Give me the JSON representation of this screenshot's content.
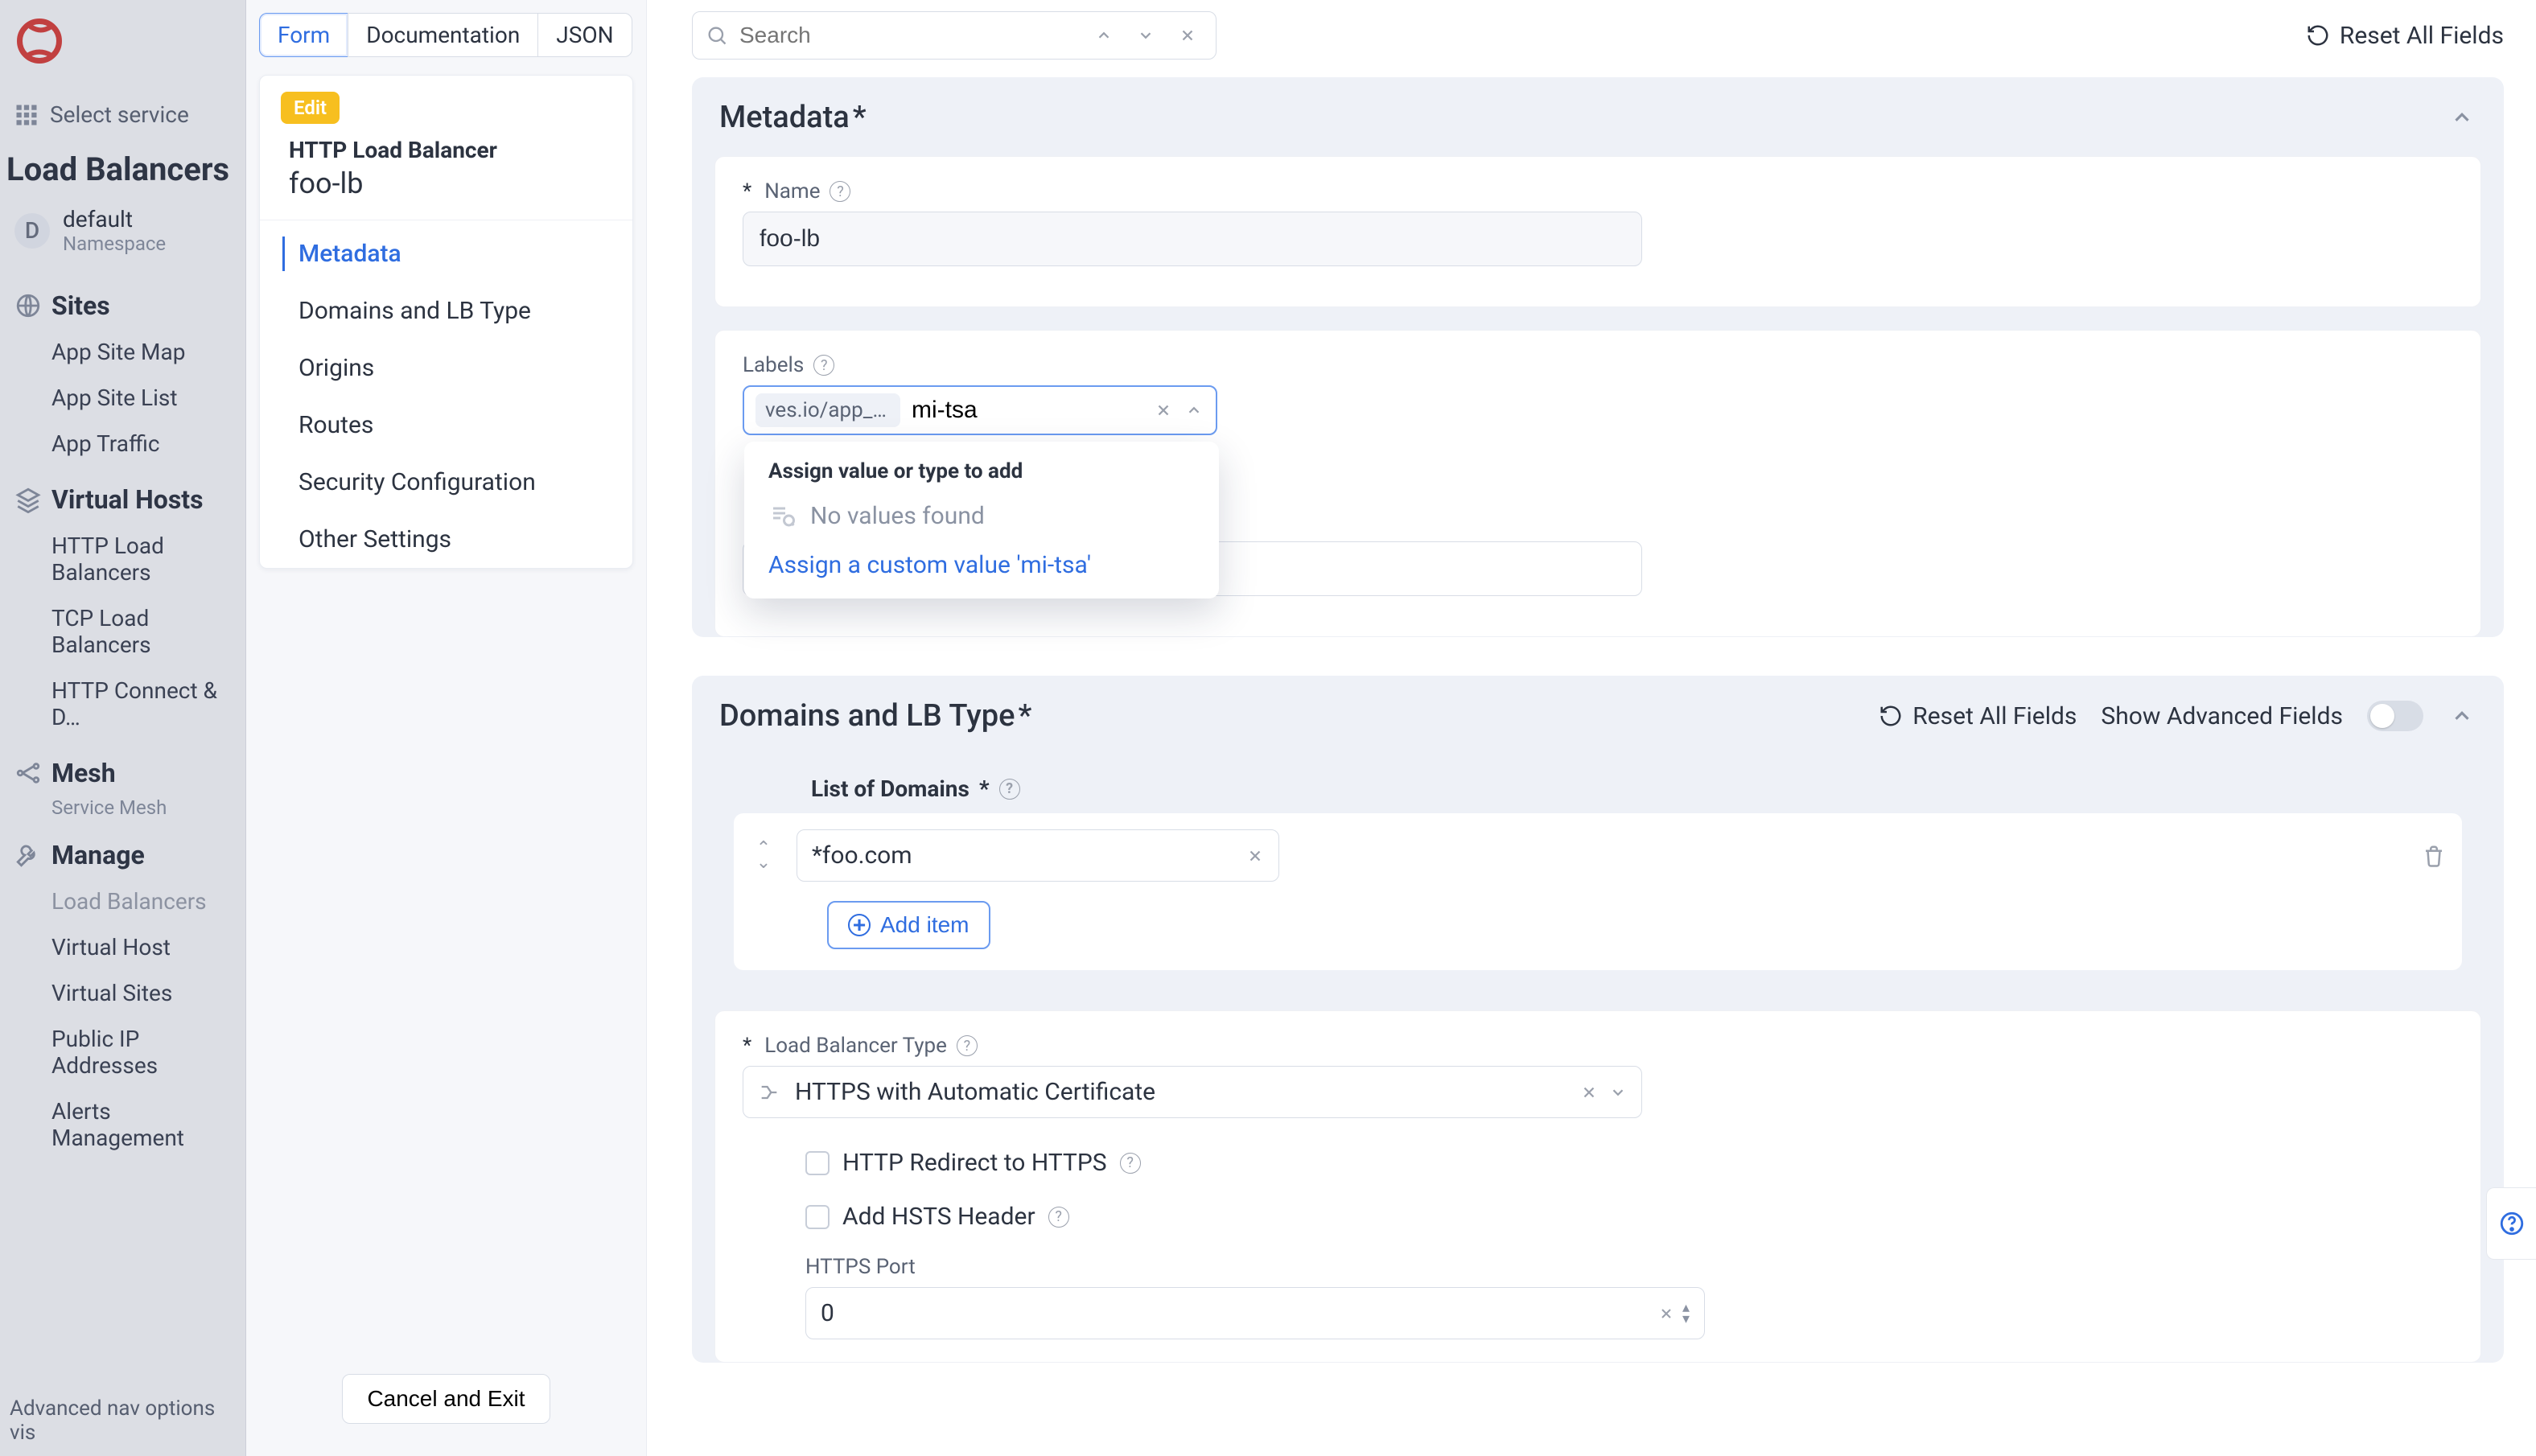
{
  "sidebar": {
    "select_service": "Select service",
    "app_title": "Load Balancers",
    "namespace": {
      "initial": "D",
      "name": "default",
      "sub": "Namespace"
    },
    "sections": [
      {
        "title": "Sites",
        "links": [
          "App Site Map",
          "App Site List",
          "App Traffic"
        ]
      },
      {
        "title": "Virtual Hosts",
        "links": [
          "HTTP Load Balancers",
          "TCP Load Balancers",
          "HTTP Connect & D…"
        ]
      },
      {
        "title": "Mesh",
        "sub": "Service Mesh",
        "links": []
      },
      {
        "title": "Manage",
        "links": [
          "Load Balancers",
          "Virtual Host",
          "Virtual Sites",
          "Public IP Addresses",
          "Alerts Management"
        ]
      }
    ],
    "adv_note": "Advanced nav options vis"
  },
  "tabs": {
    "form": "Form",
    "documentation": "Documentation",
    "json": "JSON"
  },
  "nav_card": {
    "badge": "Edit",
    "heading": "HTTP Load Balancer",
    "name": "foo-lb",
    "items": [
      "Metadata",
      "Domains and LB Type",
      "Origins",
      "Routes",
      "Security Configuration",
      "Other Settings"
    ],
    "active_index": 0,
    "cancel": "Cancel and Exit"
  },
  "topbar": {
    "search_placeholder": "Search",
    "reset_all": "Reset All Fields"
  },
  "metadata_section": {
    "title": "Metadata",
    "name_label": "Name",
    "name_value": "foo-lb",
    "labels_label": "Labels",
    "chip": "ves.io/app_t…",
    "typed": "mi-tsa",
    "dropdown": {
      "head": "Assign value or type to add",
      "none": "No values found",
      "assign": "Assign a custom value 'mi-tsa'"
    }
  },
  "domains_section": {
    "title": "Domains and LB Type",
    "reset": "Reset All Fields",
    "show_adv": "Show Advanced Fields",
    "list_label": "List of Domains",
    "domain_value": "*foo.com",
    "add_item": "Add item",
    "lb_type_label": "Load Balancer Type",
    "lb_type_value": "HTTPS with Automatic Certificate",
    "http_redirect": "HTTP Redirect to HTTPS",
    "add_hsts": "Add HSTS Header",
    "https_port_label": "HTTPS Port",
    "https_port_value": "0"
  }
}
